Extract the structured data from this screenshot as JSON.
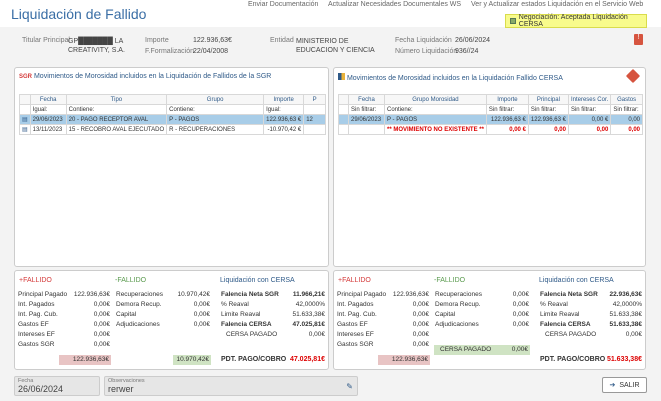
{
  "title": "Liquidación de Fallido",
  "toplinks": [
    "Enviar Documentación",
    "Actualizar Necesidades Documentales WS",
    "Ver y Actualizar estados Liquidación en el Servicio Web"
  ],
  "badge": "Negociación: Aceptada Liquidación CERSA",
  "info": {
    "titular_label": "Titular Principal",
    "titular_value": "GP███████ LA CREATIVITY, S.A.",
    "importe_label": "Importe",
    "importe_value": "122.936,63€",
    "fform_label": "F.Formalización",
    "fform_value": "22/04/2008",
    "entidad_label": "Entidad",
    "entidad_value": "MINISTERIO DE EDUCACION Y CIENCIA",
    "fliq_label": "Fecha Liquidación",
    "fliq_value": "26/06/2024",
    "numliq_label": "Número Liquidación",
    "numliq_value": "936//24"
  },
  "left": {
    "title": "Movimientos de Morosidad incluidos en la Liquidación de Fallidos de la SGR",
    "headers": [
      "Fecha",
      "Tipo",
      "Grupo",
      "Importe",
      "P"
    ],
    "filters": [
      "Igual:",
      "Contiene:",
      "Contiene:",
      "Igual:"
    ],
    "rows": [
      [
        "29/06/2023",
        "20 - PAGO RECEPTOR AVAL",
        "P - PAGOS",
        "122.936,63 €",
        "12"
      ],
      [
        "13/11/2023",
        "15 - RECOBRO AVAL EJECUTADO",
        "R - RECUPERACIONES",
        "-10.970,42 €",
        ""
      ]
    ]
  },
  "right": {
    "title": "Movimientos de Morosidad incluidos en la Liquidación Fallido CERSA",
    "headers": [
      "Fecha",
      "Grupo Morosidad",
      "Importe",
      "Principal",
      "Intereses Cor.",
      "Gastos"
    ],
    "filters": [
      "Sin filtrar:",
      "Contiene:",
      "Sin filtrar:",
      "Sin filtrar:",
      "Sin filtrar:",
      "Sin filtrar:"
    ],
    "rows": [
      [
        "29/06/2023",
        "P - PAGOS",
        "122.936,63 €",
        "122.936,63 €",
        "0,00 €",
        "0,00"
      ]
    ],
    "missing": "** MOVIMIENTO NO EXISTENTE **",
    "missing_vals": [
      "0,00 €",
      "0,00",
      "0,00",
      "0,00"
    ]
  },
  "summary_left": {
    "plus": {
      "head": "+FALLIDO",
      "rows": [
        [
          "Principal Pagado",
          "122.936,63€"
        ],
        [
          "Int. Pagados",
          "0,00€"
        ],
        [
          "Int. Pag. Cub.",
          "0,00€"
        ],
        [
          "Gastos EF",
          "0,00€"
        ],
        [
          "Intereses EF",
          "0,00€"
        ],
        [
          "Gastos SGR",
          "0,00€"
        ]
      ],
      "total": "122.936,63€"
    },
    "minus": {
      "head": "-FALLIDO",
      "rows": [
        [
          "Recuperaciones",
          "10.970,42€"
        ],
        [
          "Demora Recup.",
          "0,00€"
        ],
        [
          "Capital",
          "0,00€"
        ],
        [
          "Adjudicaciones",
          "0,00€"
        ]
      ],
      "total": "10.970,42€"
    },
    "cersa": {
      "head": "Liquidación con CERSA",
      "rows": [
        [
          "Falencia Neta SGR",
          "11.966,21€"
        ],
        [
          "% Reaval",
          "42,0000%"
        ],
        [
          "Limite Reaval",
          "51.633,38€"
        ],
        [
          "Falencia CERSA",
          "47.025,81€"
        ],
        [
          "CERSA PAGADO",
          "0,00€"
        ]
      ],
      "pdt_label": "PDT. PAGO/COBRO",
      "pdt_value": "47.025,81€"
    }
  },
  "summary_right": {
    "plus": {
      "head": "+FALLIDO",
      "rows": [
        [
          "Principal Pagado",
          "122.936,63€"
        ],
        [
          "Int. Pagados",
          "0,00€"
        ],
        [
          "Int. Pag. Cub.",
          "0,00€"
        ],
        [
          "Gastos EF",
          "0,00€"
        ],
        [
          "Intereses EF",
          "0,00€"
        ],
        [
          "Gastos SGR",
          "0,00€"
        ]
      ],
      "total": "122.936,63€"
    },
    "minus": {
      "head": "-FALLIDO",
      "rows": [
        [
          "Recuperaciones",
          "0,00€"
        ],
        [
          "Demora Recup.",
          "0,00€"
        ],
        [
          "Capital",
          "0,00€"
        ],
        [
          "Adjudicaciones",
          "0,00€"
        ]
      ],
      "cersa_pagado_label": "CERSA PAGADO",
      "cersa_pagado_value": "0,00€"
    },
    "cersa": {
      "head": "Liquidación con CERSA",
      "rows": [
        [
          "Falencia Neta SGR",
          "22.936,63€"
        ],
        [
          "% Reaval",
          "42,0000%"
        ],
        [
          "Limite Reaval",
          "51.633,38€"
        ],
        [
          "Falencia CERSA",
          "51.633,38€"
        ],
        [
          "CERSA PAGADO",
          "0,00€"
        ]
      ],
      "pdt_label": "PDT. PAGO/COBRO",
      "pdt_value": "51.633,38€"
    }
  },
  "footer": {
    "fecha_label": "Fecha",
    "fecha_value": "26/06/2024",
    "obs_label": "Observaciones",
    "obs_value": "rerwer",
    "salir": "SALIR"
  }
}
